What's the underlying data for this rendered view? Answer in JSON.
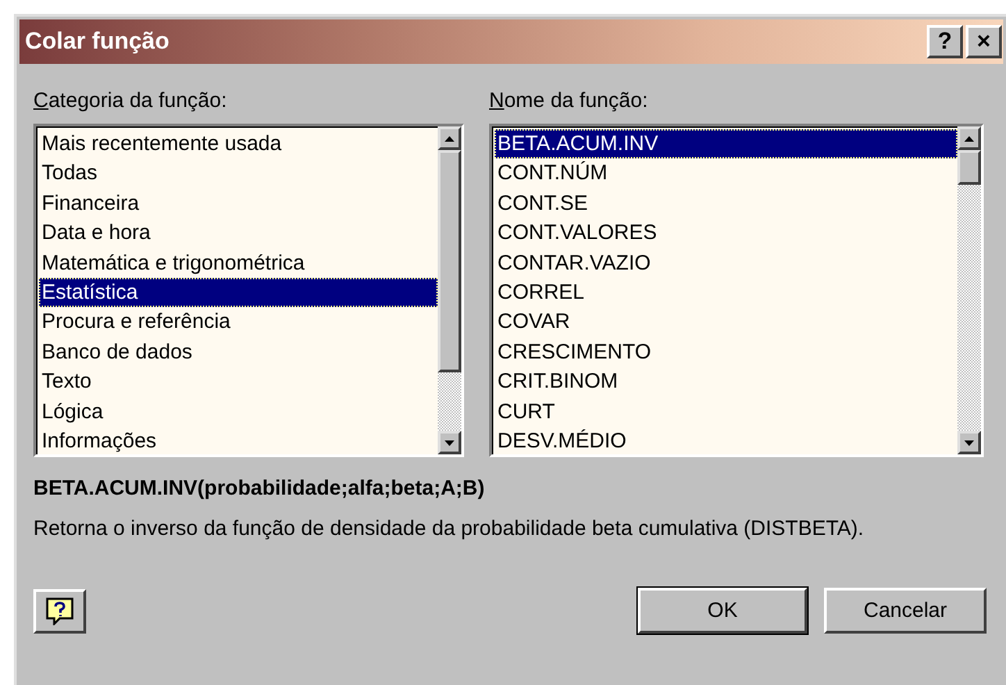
{
  "window": {
    "title": "Colar função",
    "help_button": "?",
    "close_button": "×"
  },
  "category": {
    "access_key": "C",
    "label_rest": "ategoria da função:",
    "items": [
      {
        "label": "Mais recentemente usada",
        "selected": false
      },
      {
        "label": "Todas",
        "selected": false
      },
      {
        "label": "Financeira",
        "selected": false
      },
      {
        "label": "Data e hora",
        "selected": false
      },
      {
        "label": "Matemática e trigonométrica",
        "selected": false
      },
      {
        "label": "Estatística",
        "selected": true
      },
      {
        "label": "Procura e referência",
        "selected": false
      },
      {
        "label": "Banco de dados",
        "selected": false
      },
      {
        "label": "Texto",
        "selected": false
      },
      {
        "label": "Lógica",
        "selected": false
      },
      {
        "label": "Informações",
        "selected": false
      }
    ]
  },
  "function_name": {
    "access_key": "N",
    "label_rest": "ome da função:",
    "items": [
      {
        "label": "BETA.ACUM.INV",
        "selected": true
      },
      {
        "label": "CONT.NÚM",
        "selected": false
      },
      {
        "label": "CONT.SE",
        "selected": false
      },
      {
        "label": "CONT.VALORES",
        "selected": false
      },
      {
        "label": "CONTAR.VAZIO",
        "selected": false
      },
      {
        "label": "CORREL",
        "selected": false
      },
      {
        "label": "COVAR",
        "selected": false
      },
      {
        "label": "CRESCIMENTO",
        "selected": false
      },
      {
        "label": "CRIT.BINOM",
        "selected": false
      },
      {
        "label": "CURT",
        "selected": false
      },
      {
        "label": "DESV.MÉDIO",
        "selected": false
      }
    ]
  },
  "syntax": "BETA.ACUM.INV(probabilidade;alfa;beta;A;B)",
  "description": "Retorna o inverso da função de densidade da probabilidade beta cumulativa (DISTBETA).",
  "buttons": [
    {
      "label": "OK",
      "default": true
    },
    {
      "label": "Cancelar",
      "default": false
    }
  ]
}
